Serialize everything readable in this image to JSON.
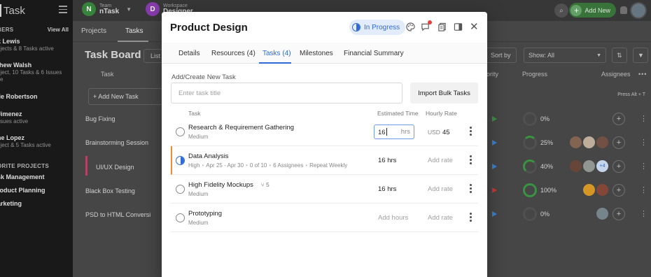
{
  "sidebar": {
    "logo": "Task",
    "members_label": "BERS",
    "view_all": "View All",
    "members": [
      {
        "name": "k Lewis",
        "sub": "ojects & 8 Tasks active"
      },
      {
        "name": "thew Walsh",
        "sub": "oject, 10 Tasks & 6 Issues",
        "sub2": "ve"
      },
      {
        "name": "lie Robertson",
        "sub": ""
      },
      {
        "name": "Jimenez",
        "sub": "ssues active"
      },
      {
        "name": "ne Lopez",
        "sub": "oject & 5 Tasks active"
      }
    ],
    "favorites_label": "ORITE PROJECTS",
    "favorites": [
      "sk Management",
      "roduct Planning",
      "arketing"
    ]
  },
  "topbar": {
    "team_small": "Team",
    "team_name": "nTask",
    "team_badge": "N",
    "workspace_small": "Workspace",
    "workspace_name": "Designer",
    "workspace_badge": "D",
    "search_icon": "search-icon",
    "add_new": "Add New"
  },
  "background": {
    "tabs": [
      "Projects",
      "Tasks"
    ],
    "board_title": "Task Board",
    "list_btn": "List",
    "sort_by": "Sort by",
    "show_all": "Show: All",
    "headers": {
      "task": "Task",
      "priority": "riority",
      "progress": "Progress",
      "assignees": "Assignees"
    },
    "add_new_task": "+ Add New Task",
    "press_alt": "Press Alt + T",
    "rows": [
      {
        "name": "Bug Fixing",
        "progress": "0%"
      },
      {
        "name": "Brainstorming Session",
        "progress": "25%"
      },
      {
        "name": "UI/UX Design",
        "progress": "40%",
        "extra": "+4"
      },
      {
        "name": "Black Box Testing",
        "progress": "100%"
      },
      {
        "name": "PSD to HTML Conversi",
        "progress": "0%"
      }
    ]
  },
  "modal": {
    "title": "Product Design",
    "status": "In Progress",
    "tabs": [
      "Details",
      "Resources (4)",
      "Tasks (4)",
      "Milestones",
      "Financial Summary"
    ],
    "active_tab": "Tasks (4)",
    "section_label": "Add/Create New Task",
    "input_placeholder": "Enter task title",
    "bulk_button": "Import Bulk Tasks",
    "columns": {
      "task": "Task",
      "estimated": "Estimated Time",
      "rate": "Hourly Rate"
    },
    "tasks": [
      {
        "name": "Research & Requirement Gathering",
        "priority": "Medium",
        "hours": "16",
        "hours_unit": "hrs",
        "rate_currency": "USD",
        "rate_value": "45",
        "status": "open"
      },
      {
        "name": "Data Analysis",
        "priority": "High",
        "dates": "Apr 25 - Apr 30",
        "checklist": "0 of 10",
        "assignees": "6 Assignees",
        "repeat": "Repeat Weekly",
        "hours": "16 hrs",
        "rate": "Add rate",
        "status": "in-progress"
      },
      {
        "name": "High Fidelity Mockups",
        "subtasks": "5",
        "priority": "Medium",
        "hours": "16 hrs",
        "rate": "Add rate",
        "status": "open"
      },
      {
        "name": "Prototyping",
        "priority": "Medium",
        "hours": "Add hours",
        "rate": "Add rate",
        "status": "open"
      }
    ]
  },
  "colors": {
    "accent": "#2f6ad8",
    "status_bg": "#e3ecfb",
    "highlight_bar": "#f28a2e",
    "team_badge": "#3b8b3f",
    "workspace_badge": "#8e3fb5"
  }
}
